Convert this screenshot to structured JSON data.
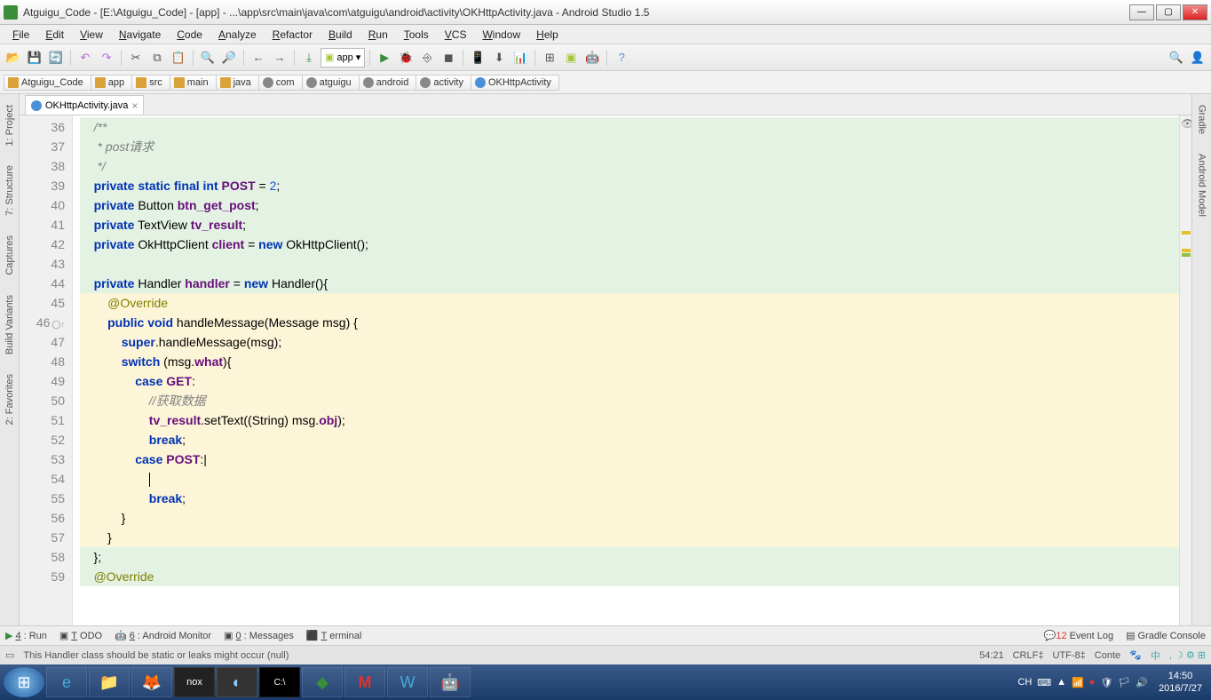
{
  "window": {
    "title": "Atguigu_Code - [E:\\Atguigu_Code] - [app] - ...\\app\\src\\main\\java\\com\\atguigu\\android\\activity\\OKHttpActivity.java - Android Studio 1.5"
  },
  "menu": [
    "File",
    "Edit",
    "View",
    "Navigate",
    "Code",
    "Analyze",
    "Refactor",
    "Build",
    "Run",
    "Tools",
    "VCS",
    "Window",
    "Help"
  ],
  "run_config": "app",
  "breadcrumbs": [
    {
      "label": "Atguigu_Code",
      "icon": "fld"
    },
    {
      "label": "app",
      "icon": "fld"
    },
    {
      "label": "src",
      "icon": "fld"
    },
    {
      "label": "main",
      "icon": "fld"
    },
    {
      "label": "java",
      "icon": "fld"
    },
    {
      "label": "com",
      "icon": "pkg"
    },
    {
      "label": "atguigu",
      "icon": "pkg"
    },
    {
      "label": "android",
      "icon": "pkg"
    },
    {
      "label": "activity",
      "icon": "pkg"
    },
    {
      "label": "OKHttpActivity",
      "icon": "cls"
    }
  ],
  "left_tabs": [
    "1: Project",
    "7: Structure",
    "Captures",
    "Build Variants",
    "2: Favorites"
  ],
  "right_tabs": [
    "Gradle",
    "Android Model"
  ],
  "file_tab": "OKHttpActivity.java",
  "code_lines": [
    {
      "n": 36,
      "bg": "g",
      "html": "    <span class='comment'>/**</span>"
    },
    {
      "n": 37,
      "bg": "g",
      "html": "    <span class='comment'> * post请求</span>"
    },
    {
      "n": 38,
      "bg": "g",
      "html": "    <span class='comment'> */</span>"
    },
    {
      "n": 39,
      "bg": "g",
      "html": "    <span class='kw'>private</span> <span class='kw'>static</span> <span class='kw'>final</span> <span class='kw'>int</span> <span class='ident'>POST</span> = <span class='num'>2</span>;"
    },
    {
      "n": 40,
      "bg": "g",
      "html": "    <span class='kw'>private</span> Button <span class='ident'>btn_get_post</span>;"
    },
    {
      "n": 41,
      "bg": "g",
      "html": "    <span class='kw'>private</span> TextView <span class='ident'>tv_result</span>;"
    },
    {
      "n": 42,
      "bg": "g",
      "html": "    <span class='kw'>private</span> OkHttpClient <span class='ident'>client</span> = <span class='kw'>new</span> OkHttpClient();"
    },
    {
      "n": 43,
      "bg": "g",
      "html": ""
    },
    {
      "n": 44,
      "bg": "g",
      "html": "    <span class='kw'>private</span> Handler <span class='ident'>handler</span> = <span class='kw'>new</span> Handler(){"
    },
    {
      "n": 45,
      "bg": "y",
      "html": "        <span class='ann'>@Override</span>"
    },
    {
      "n": 46,
      "bg": "y",
      "ovr": true,
      "html": "        <span class='kw'>public</span> <span class='kw'>void</span> <span class='type'>handleMessage</span>(Message msg) {"
    },
    {
      "n": 47,
      "bg": "y",
      "html": "            <span class='kw'>super</span>.handleMessage(msg);"
    },
    {
      "n": 48,
      "bg": "y",
      "html": "            <span class='kw'>switch</span> (msg.<span class='ident'>what</span>){"
    },
    {
      "n": 49,
      "bg": "y",
      "html": "                <span class='kw'>case</span> <span class='ident'>GET</span>:"
    },
    {
      "n": 50,
      "bg": "y",
      "html": "                    <span class='comment'>//获取数据</span>"
    },
    {
      "n": 51,
      "bg": "y",
      "html": "                    <span class='ident'>tv_result</span>.setText((String) msg.<span class='ident'>obj</span>);"
    },
    {
      "n": 52,
      "bg": "y",
      "html": "                    <span class='kw'>break</span>;"
    },
    {
      "n": 53,
      "bg": "y",
      "html": "                <span class='kw'>case</span> <span class='ident'>POST</span>:<span style='color:#000'>|</span>"
    },
    {
      "n": 54,
      "bg": "y",
      "html": "                    <span class='caret'></span>"
    },
    {
      "n": 55,
      "bg": "y",
      "html": "                    <span class='kw'>break</span>;"
    },
    {
      "n": 56,
      "bg": "y",
      "html": "            }"
    },
    {
      "n": 57,
      "bg": "y",
      "html": "        }"
    },
    {
      "n": 58,
      "bg": "g",
      "html": "    };"
    },
    {
      "n": 59,
      "bg": "g",
      "html": "    <span class='ann'>@Override</span>"
    }
  ],
  "bottom_tools": {
    "left": [
      "4: Run",
      "TODO",
      "6: Android Monitor",
      "0: Messages",
      "Terminal"
    ],
    "right": [
      "12 Event Log",
      "Gradle Console"
    ],
    "eventlog_badge": "12"
  },
  "status": {
    "msg": "This Handler class should be static or leaks might occur (null)",
    "pos": "54:21",
    "crlf": "CRLF",
    "enc": "UTF-8",
    "ctx": "Conte"
  },
  "tray": {
    "lang": "CH",
    "time": "14:50",
    "date": "2016/7/27",
    "chn": "中"
  }
}
